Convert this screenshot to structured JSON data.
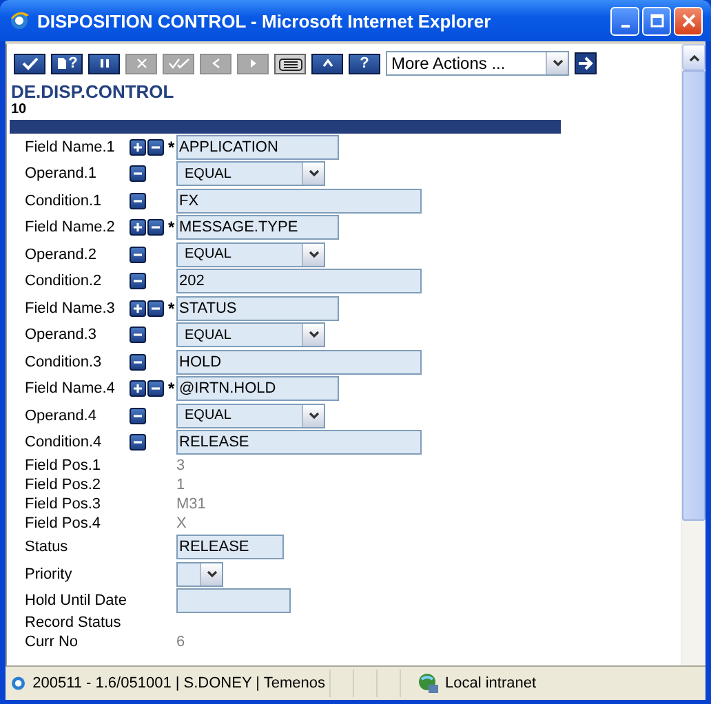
{
  "window": {
    "title": "DISPOSITION CONTROL - Microsoft Internet Explorer"
  },
  "toolbar": {
    "buttons": [
      {
        "kind": "commit",
        "disabled": false
      },
      {
        "kind": "page-help",
        "disabled": false,
        "label": "?"
      },
      {
        "kind": "hold",
        "disabled": false
      },
      {
        "kind": "delete",
        "disabled": true
      },
      {
        "kind": "authorise",
        "disabled": true
      },
      {
        "kind": "previous",
        "disabled": true
      },
      {
        "kind": "next",
        "disabled": true
      },
      {
        "kind": "print",
        "disabled": false
      },
      {
        "kind": "up",
        "disabled": false
      },
      {
        "kind": "help",
        "disabled": false,
        "label": "?"
      }
    ],
    "more_actions": {
      "value": "More Actions ..."
    }
  },
  "record": {
    "application": "DE.DISP.CONTROL",
    "id": "10"
  },
  "rows": [
    {
      "kind": "field",
      "label": "Field Name.1",
      "mandatory": "*",
      "value": "APPLICATION"
    },
    {
      "kind": "operand",
      "label": "Operand.1",
      "value": "EQUAL"
    },
    {
      "kind": "condition",
      "label": "Condition.1",
      "value": "FX"
    },
    {
      "kind": "field",
      "label": "Field Name.2",
      "mandatory": "*",
      "value": "MESSAGE.TYPE"
    },
    {
      "kind": "operand",
      "label": "Operand.2",
      "value": "EQUAL"
    },
    {
      "kind": "condition",
      "label": "Condition.2",
      "value": "202"
    },
    {
      "kind": "field",
      "label": "Field Name.3",
      "mandatory": "*",
      "value": "STATUS"
    },
    {
      "kind": "operand",
      "label": "Operand.3",
      "value": "EQUAL"
    },
    {
      "kind": "condition",
      "label": "Condition.3",
      "value": "HOLD"
    },
    {
      "kind": "field",
      "label": "Field Name.4",
      "mandatory": "*",
      "value": "@IRTN.HOLD"
    },
    {
      "kind": "operand",
      "label": "Operand.4",
      "value": "EQUAL"
    },
    {
      "kind": "condition",
      "label": "Condition.4",
      "value": "RELEASE"
    },
    {
      "kind": "readonly",
      "label": "Field Pos.1",
      "value": "3"
    },
    {
      "kind": "readonly",
      "label": "Field Pos.2",
      "value": "1"
    },
    {
      "kind": "readonly",
      "label": "Field Pos.3",
      "value": "M31"
    },
    {
      "kind": "readonly",
      "label": "Field Pos.4",
      "value": "X"
    },
    {
      "kind": "input",
      "label": "Status",
      "value": "RELEASE"
    },
    {
      "kind": "select",
      "label": "Priority"
    },
    {
      "kind": "date",
      "label": "Hold Until Date"
    },
    {
      "kind": "readonly",
      "label": "Record Status"
    },
    {
      "kind": "readonly",
      "label": "Curr No",
      "value": "6"
    }
  ],
  "status_bar": {
    "text": "200511 - 1.6/051001 | S.DONEY | Temenos",
    "zone": "Local intranet"
  }
}
